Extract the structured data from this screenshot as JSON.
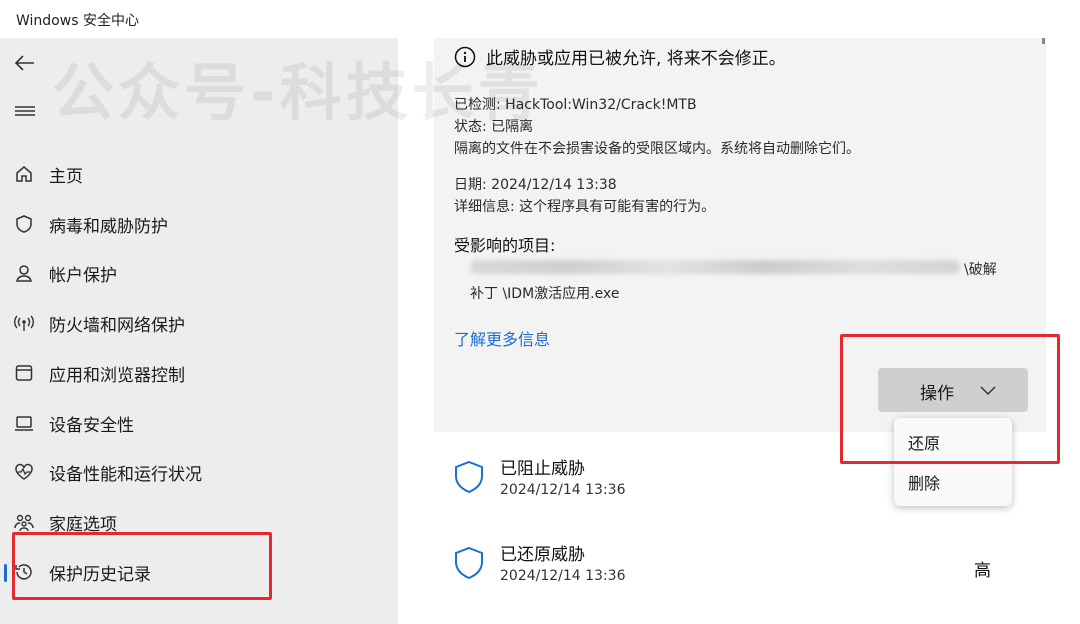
{
  "window": {
    "title": "Windows 安全中心"
  },
  "watermark": "公众号-科技长青",
  "sidebar": {
    "items": [
      {
        "label": "主页"
      },
      {
        "label": "病毒和威胁防护"
      },
      {
        "label": "帐户保护"
      },
      {
        "label": "防火墙和网络保护"
      },
      {
        "label": "应用和浏览器控制"
      },
      {
        "label": "设备安全性"
      },
      {
        "label": "设备性能和运行状况"
      },
      {
        "label": "家庭选项"
      },
      {
        "label": "保护历史记录",
        "selected": true
      }
    ]
  },
  "detail": {
    "info": "此威胁或应用已被允许, 将来不会修正。",
    "detected": "已检测: HackTool:Win32/Crack!MTB",
    "status": "状态: 已隔离",
    "quarantine_note": "隔离的文件在不会损害设备的受限区域内。系统将自动删除它们。",
    "date": "日期:  2024/12/14 13:38",
    "details": "详细信息: 这个程序具有可能有害的行为。",
    "affected_title": "受影响的项目:",
    "path_tail": "\\破解",
    "path_line2": "补丁 \\IDM激活应用.exe",
    "learn_more": "了解更多信息",
    "action_label": "操作",
    "dropdown": [
      "还原",
      "删除"
    ]
  },
  "threats": [
    {
      "name": "已阻止威胁",
      "date": "2024/12/14 13:36",
      "severity": ""
    },
    {
      "name": "已还原威胁",
      "date": "2024/12/14 13:36",
      "severity": "高"
    }
  ],
  "colors": {
    "accent": "#1a6fd1",
    "highlight": "#e32b2b",
    "sidebar_bg": "#ededed",
    "card_bg": "#f3f3f3"
  }
}
